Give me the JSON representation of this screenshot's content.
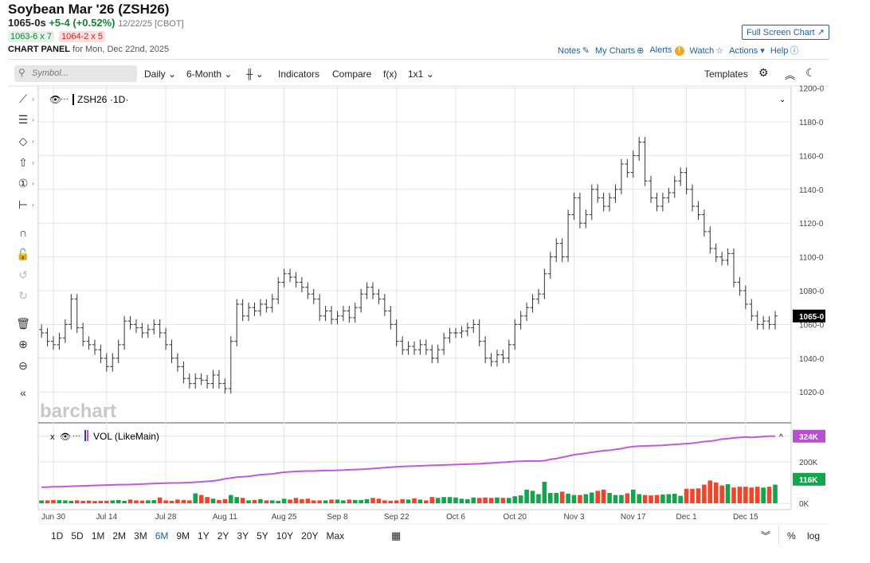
{
  "header": {
    "title": "Soybean Mar '26 (ZSH26)",
    "last": "1065-0s",
    "change": "+5-4 (+0.52%)",
    "date": "12/22/25 [CBOT]",
    "bid": "1063-6 x 7",
    "ask": "1064-2 x 5",
    "panel_label": "CHART PANEL",
    "panel_date": "for Mon, Dec 22nd, 2025",
    "fullscreen": "Full Screen Chart"
  },
  "links": {
    "notes": "Notes",
    "my_charts": "My Charts",
    "alerts": "Alerts",
    "watch": "Watch",
    "actions": "Actions",
    "help": "Help"
  },
  "toolbar": {
    "search_placeholder": "Symbol...",
    "interval": "Daily",
    "range": "6-Month",
    "indicators": "Indicators",
    "compare": "Compare",
    "fx": "f(x)",
    "layout": "1x1",
    "templates": "Templates"
  },
  "legend": {
    "symbol": "ZSH26",
    "interval": "·1D·",
    "volume": "VOL (LikeMain)",
    "watermark": "barchart"
  },
  "colors": {
    "up": "#14a44d",
    "down": "#f0452a",
    "neutral": "#2b3fb0",
    "oi": "#c05ad8",
    "price_tag": "#000000",
    "vol_tag": "#14a44d",
    "oi_tag": "#b84fd0",
    "accent": "#1f5fa8"
  },
  "chart_data": {
    "type": "ohlc",
    "price_axis": {
      "ticks": [
        "1200-0",
        "1180-0",
        "1160-0",
        "1140-0",
        "1120-0",
        "1100-0",
        "1080-0",
        "1060-0",
        "1040-0",
        "1020-0"
      ],
      "values": [
        1200,
        1180,
        1160,
        1140,
        1120,
        1100,
        1080,
        1060,
        1040,
        1020
      ],
      "last_label": "1065-0",
      "last": 1065
    },
    "volume_axis": {
      "ticks": [
        "200K",
        "0K"
      ],
      "values": [
        200,
        0
      ],
      "oi_label": "324K",
      "oi_last": 324,
      "vol_label": "116K",
      "vol_last": 116
    },
    "x_ticks": [
      "Jun 30",
      "Jul 14",
      "Jul 28",
      "Aug 11",
      "Aug 25",
      "Sep 8",
      "Sep 22",
      "Oct 6",
      "Oct 20",
      "Nov 3",
      "Nov 17",
      "Dec 1",
      "Dec 15"
    ],
    "dates": [
      "Jun 26",
      "Jun 27",
      "Jun 30",
      "Jul 1",
      "Jul 2",
      "Jul 3",
      "Jul 7",
      "Jul 8",
      "Jul 9",
      "Jul 10",
      "Jul 11",
      "Jul 14",
      "Jul 15",
      "Jul 16",
      "Jul 17",
      "Jul 18",
      "Jul 21",
      "Jul 22",
      "Jul 23",
      "Jul 24",
      "Jul 25",
      "Jul 28",
      "Jul 29",
      "Jul 30",
      "Jul 31",
      "Aug 1",
      "Aug 4",
      "Aug 5",
      "Aug 6",
      "Aug 7",
      "Aug 8",
      "Aug 11",
      "Aug 12",
      "Aug 13",
      "Aug 14",
      "Aug 15",
      "Aug 18",
      "Aug 19",
      "Aug 20",
      "Aug 21",
      "Aug 22",
      "Aug 25",
      "Aug 26",
      "Aug 27",
      "Aug 28",
      "Aug 29",
      "Sep 2",
      "Sep 3",
      "Sep 4",
      "Sep 5",
      "Sep 8",
      "Sep 9",
      "Sep 10",
      "Sep 11",
      "Sep 12",
      "Sep 15",
      "Sep 16",
      "Sep 17",
      "Sep 18",
      "Sep 19",
      "Sep 22",
      "Sep 23",
      "Sep 24",
      "Sep 25",
      "Sep 26",
      "Sep 29",
      "Sep 30",
      "Oct 1",
      "Oct 2",
      "Oct 3",
      "Oct 6",
      "Oct 7",
      "Oct 8",
      "Oct 9",
      "Oct 10",
      "Oct 13",
      "Oct 14",
      "Oct 15",
      "Oct 16",
      "Oct 17",
      "Oct 20",
      "Oct 21",
      "Oct 22",
      "Oct 23",
      "Oct 24",
      "Oct 27",
      "Oct 28",
      "Oct 29",
      "Oct 30",
      "Oct 31",
      "Nov 3",
      "Nov 4",
      "Nov 5",
      "Nov 6",
      "Nov 7",
      "Nov 10",
      "Nov 11",
      "Nov 12",
      "Nov 13",
      "Nov 14",
      "Nov 17",
      "Nov 18",
      "Nov 19",
      "Nov 20",
      "Nov 21",
      "Nov 24",
      "Nov 25",
      "Nov 26",
      "Nov 28",
      "Dec 1",
      "Dec 2",
      "Dec 3",
      "Dec 4",
      "Dec 5",
      "Dec 8",
      "Dec 9",
      "Dec 10",
      "Dec 11",
      "Dec 12",
      "Dec 15",
      "Dec 16",
      "Dec 17",
      "Dec 18",
      "Dec 19",
      "Dec 22"
    ],
    "close": [
      1055,
      1050,
      1048,
      1052,
      1060,
      1075,
      1058,
      1050,
      1048,
      1045,
      1040,
      1035,
      1040,
      1048,
      1062,
      1060,
      1058,
      1055,
      1057,
      1060,
      1055,
      1048,
      1040,
      1035,
      1028,
      1025,
      1028,
      1027,
      1025,
      1030,
      1025,
      1022,
      1050,
      1072,
      1065,
      1070,
      1068,
      1072,
      1070,
      1075,
      1085,
      1090,
      1088,
      1085,
      1082,
      1078,
      1075,
      1065,
      1068,
      1063,
      1065,
      1068,
      1064,
      1070,
      1078,
      1082,
      1078,
      1075,
      1068,
      1060,
      1050,
      1045,
      1047,
      1045,
      1048,
      1045,
      1040,
      1045,
      1052,
      1055,
      1055,
      1056,
      1058,
      1060,
      1050,
      1040,
      1038,
      1042,
      1040,
      1048,
      1060,
      1065,
      1070,
      1075,
      1078,
      1090,
      1100,
      1108,
      1100,
      1125,
      1135,
      1120,
      1125,
      1140,
      1135,
      1130,
      1135,
      1140,
      1155,
      1150,
      1160,
      1168,
      1145,
      1135,
      1130,
      1135,
      1138,
      1145,
      1150,
      1140,
      1130,
      1125,
      1115,
      1105,
      1100,
      1098,
      1102,
      1085,
      1080,
      1072,
      1065,
      1060,
      1062,
      1060,
      1065
    ],
    "volume_k": [
      14,
      14,
      16,
      15,
      14,
      12,
      14,
      12,
      13,
      11,
      12,
      12,
      14,
      16,
      12,
      18,
      14,
      13,
      14,
      15,
      28,
      14,
      12,
      18,
      16,
      14,
      48,
      40,
      30,
      22,
      16,
      20,
      40,
      30,
      26,
      14,
      16,
      20,
      14,
      14,
      12,
      22,
      18,
      26,
      20,
      22,
      14,
      14,
      14,
      18,
      18,
      14,
      18,
      16,
      16,
      20,
      26,
      22,
      14,
      12,
      14,
      20,
      18,
      24,
      18,
      14,
      30,
      26,
      30,
      30,
      28,
      22,
      20,
      28,
      26,
      28,
      26,
      28,
      26,
      26,
      34,
      38,
      66,
      60,
      44,
      104,
      50,
      50,
      56,
      46,
      40,
      40,
      44,
      52,
      60,
      66,
      50,
      40,
      40,
      48,
      66,
      44,
      40,
      38,
      40,
      42,
      44,
      46,
      36,
      70,
      70,
      72,
      90,
      110,
      100,
      86,
      92,
      76,
      80,
      80,
      76,
      80,
      76,
      80,
      90,
      116
    ],
    "open_interest_k": [
      78,
      78,
      80,
      80,
      81,
      82,
      83,
      84,
      85,
      86,
      87,
      88,
      89,
      90,
      90,
      91,
      92,
      93,
      94,
      95,
      96,
      97,
      98,
      98,
      99,
      100,
      102,
      104,
      106,
      108,
      112,
      118,
      122,
      126,
      128,
      130,
      134,
      138,
      140,
      142,
      146,
      150,
      152,
      154,
      155,
      156,
      156,
      157,
      158,
      158,
      159,
      160,
      162,
      163,
      164,
      166,
      168,
      170,
      172,
      174,
      176,
      178,
      179,
      180,
      181,
      182,
      183,
      184,
      185,
      186,
      187,
      188,
      189,
      190,
      191,
      193,
      194,
      196,
      198,
      200,
      202,
      203,
      204,
      205,
      204,
      206,
      212,
      216,
      222,
      228,
      234,
      238,
      242,
      246,
      250,
      254,
      256,
      260,
      264,
      270,
      274,
      276,
      277,
      278,
      279,
      280,
      282,
      284,
      286,
      288,
      290,
      294,
      298,
      300,
      304,
      310,
      312,
      316,
      318,
      320,
      318,
      320,
      322,
      324,
      324
    ]
  },
  "left_tools": [
    "line-tool",
    "fib-tool",
    "shape-tool",
    "arrow-tool",
    "annotation-tool",
    "measure-tool",
    "magnet-tool",
    "lock-tool",
    "undo-tool",
    "redo-tool",
    "delete-tool",
    "zoom-in-tool",
    "zoom-out-tool",
    "collapse-tool"
  ],
  "bottom": {
    "ranges": [
      "1D",
      "5D",
      "1M",
      "2M",
      "3M",
      "6M",
      "9M",
      "1Y",
      "2Y",
      "3Y",
      "5Y",
      "10Y",
      "20Y",
      "Max"
    ],
    "selected": "6M",
    "percent": "%",
    "log": "log"
  }
}
